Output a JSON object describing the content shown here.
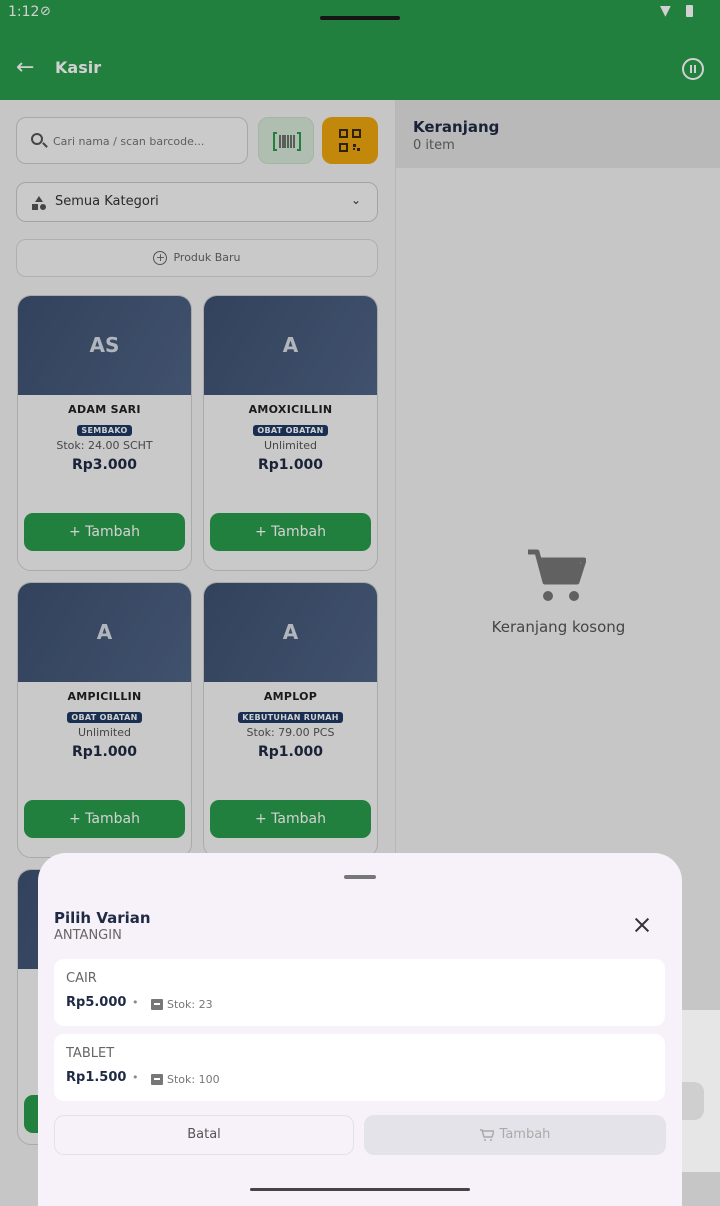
{
  "status_bar": {
    "time": "1:12"
  },
  "app_bar": {
    "title": "Kasir"
  },
  "search": {
    "placeholder": "Cari nama / scan barcode..."
  },
  "category_select": {
    "selected": "Semua Kategori"
  },
  "new_product": {
    "label": "Produk Baru"
  },
  "products": [
    {
      "initials": "AS",
      "name": "ADAM SARI",
      "category": "SEMBAKO",
      "stock": "Stok: 24.00 SCHT",
      "price": "Rp3.000",
      "add_label": "+ Tambah"
    },
    {
      "initials": "A",
      "name": "AMOXICILLIN",
      "category": "OBAT OBATAN",
      "stock": "Unlimited",
      "price": "Rp1.000",
      "add_label": "+ Tambah"
    },
    {
      "initials": "A",
      "name": "AMPICILLIN",
      "category": "OBAT OBATAN",
      "stock": "Unlimited",
      "price": "Rp1.000",
      "add_label": "+ Tambah"
    },
    {
      "initials": "A",
      "name": "AMPLOP",
      "category": "KEBUTUHAN RUMAH",
      "stock": "Stok: 79.00 PCS",
      "price": "Rp1.000",
      "add_label": "+ Tambah"
    }
  ],
  "cart": {
    "title": "Keranjang",
    "count": "0 item",
    "empty_text": "Keranjang kosong"
  },
  "variant_sheet": {
    "title": "Pilih Varian",
    "product": "ANTANGIN",
    "variants": [
      {
        "name": "CAIR",
        "price": "Rp5.000",
        "separator": "•",
        "stock": "Stok: 23"
      },
      {
        "name": "TABLET",
        "price": "Rp1.500",
        "separator": "•",
        "stock": "Stok: 100"
      }
    ],
    "cancel_label": "Batal",
    "add_label": "Tambah"
  },
  "colors": {
    "primary": "#2a9d4c",
    "accent": "#eca70f",
    "navy": "#1f2a44"
  }
}
